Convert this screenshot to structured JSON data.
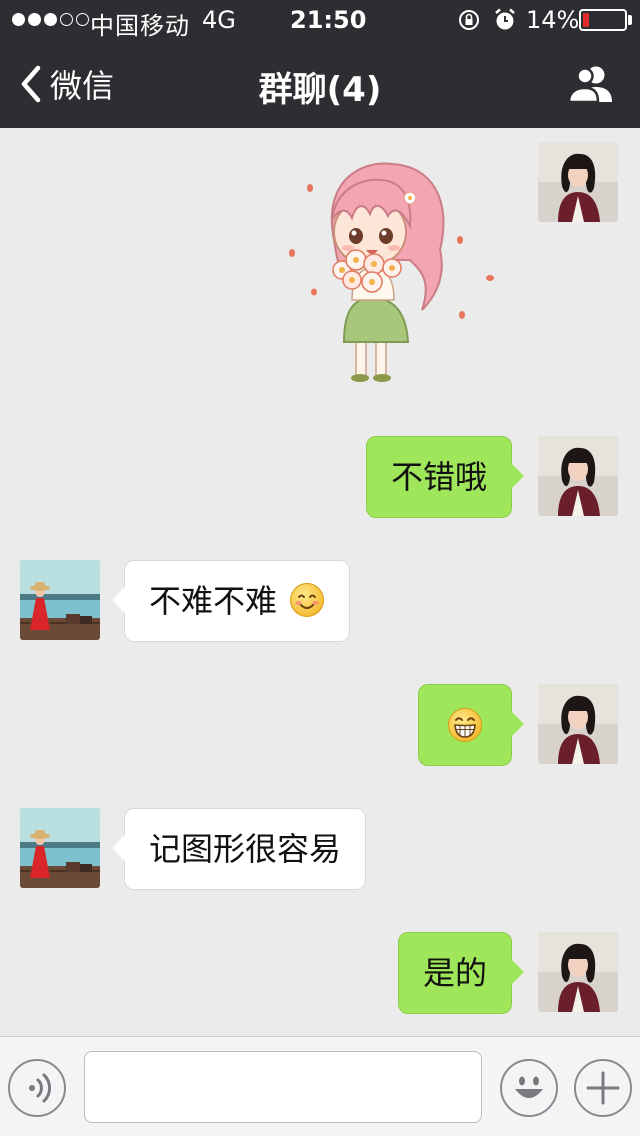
{
  "status_bar": {
    "carrier": "中国移动",
    "network": "4G",
    "time": "21:50",
    "battery": "14%",
    "battery_level": 0.14,
    "signal_bars": 3,
    "signal_total": 5
  },
  "nav": {
    "back_label": "微信",
    "title": "群聊(4)"
  },
  "messages": [
    {
      "side": "out",
      "kind": "sticker",
      "sticker": "girl-with-flowers"
    },
    {
      "side": "out",
      "kind": "text",
      "text": "不错哦"
    },
    {
      "side": "in",
      "kind": "text",
      "text": "不难不难",
      "emoji": "smile-emoji"
    },
    {
      "side": "out",
      "kind": "emoji",
      "emoji": "grin-emoji"
    },
    {
      "side": "in",
      "kind": "text",
      "text": "记图形很容易"
    },
    {
      "side": "out",
      "kind": "text",
      "text": "是的"
    }
  ],
  "input": {
    "value": "",
    "placeholder": ""
  },
  "colors": {
    "header": "#2d2e32",
    "chat_bg": "#ebebeb",
    "outgoing_bubble": "#9fe65a",
    "incoming_bubble": "#ffffff",
    "battery_low": "#e02b2b"
  }
}
